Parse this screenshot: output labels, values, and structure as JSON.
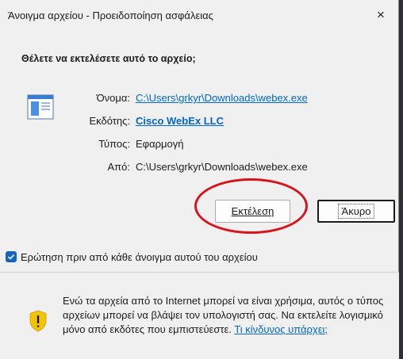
{
  "window": {
    "title": "Άνοιγμα αρχείου - Προειδοποίηση ασφάλειας",
    "close_glyph": "×"
  },
  "prompt": {
    "question": "Θέλετε να εκτελέσετε αυτό το αρχείο;"
  },
  "file_info": {
    "icon": "executable-file-icon",
    "name_label": "Όνομα:",
    "name_value": "C:\\Users\\grkyr\\Downloads\\webex.exe",
    "publisher_label": "Εκδότης:",
    "publisher_value": "Cisco WebEx LLC",
    "type_label": "Τύπος:",
    "type_value": "Εφαρμογή",
    "from_label": "Από:",
    "from_value": "C:\\Users\\grkyr\\Downloads\\webex.exe"
  },
  "buttons": {
    "run_label": "Εκτέλεση",
    "cancel_label": "Άκυρο"
  },
  "checkbox": {
    "label": "Ερώτηση πριν από κάθε άνοιγμα αυτού του αρχείου",
    "checked": true
  },
  "warning": {
    "icon": "warning-shield-icon",
    "text": "Ενώ τα αρχεία από το Internet μπορεί να είναι χρήσιμα, αυτός ο τύπος αρχείων μπορεί να βλάψει τον υπολογιστή σας. Να εκτελείτε λογισμικό μόνο από εκδότες που εμπιστεύεστε.",
    "link": "Τι κίνδυνος υπάρχει;"
  },
  "colors": {
    "accent": "#0066cc",
    "highlight": "#d6141d",
    "checkbox": "#1565c0",
    "shield": "#f5c400"
  }
}
